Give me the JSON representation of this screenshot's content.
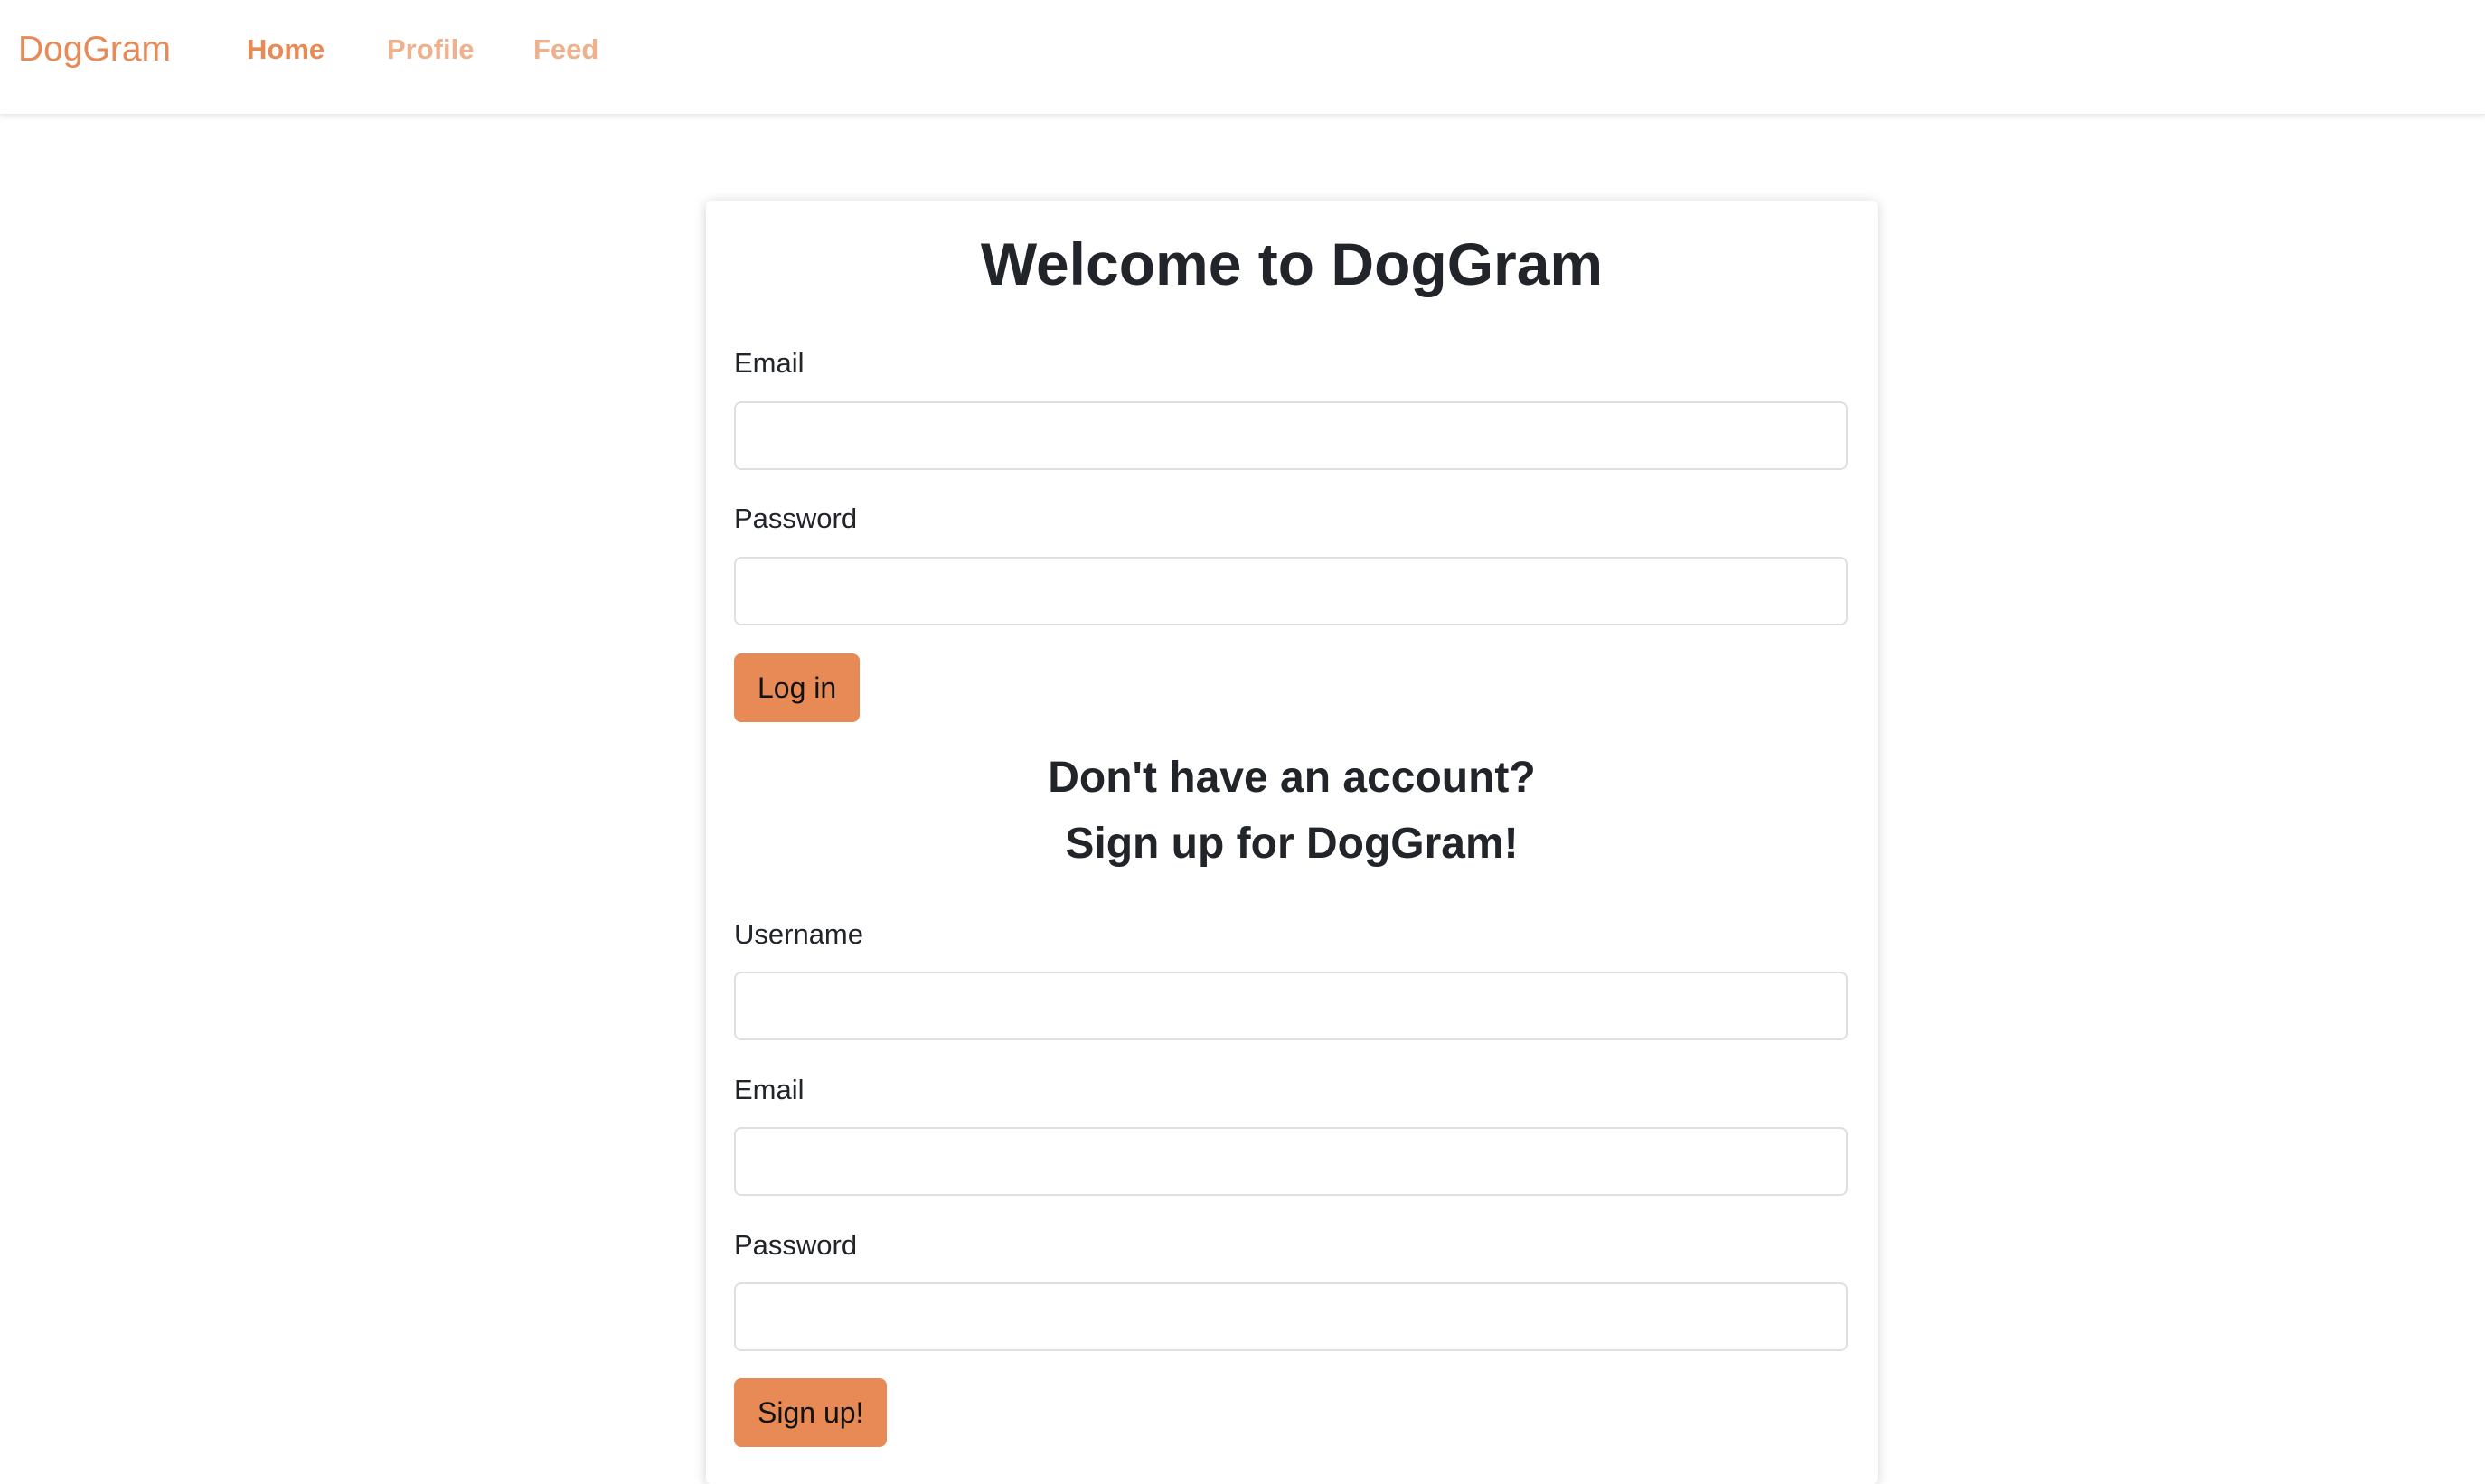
{
  "nav": {
    "brand": "DogGram",
    "links": [
      {
        "label": "Home",
        "active": true
      },
      {
        "label": "Profile",
        "active": false
      },
      {
        "label": "Feed",
        "active": false
      }
    ]
  },
  "colors": {
    "accent": "#e88a55",
    "accent_muted": "#efb08c",
    "text": "#212529"
  },
  "login": {
    "title": "Welcome to DogGram",
    "email_label": "Email",
    "email_value": "",
    "password_label": "Password",
    "password_value": "",
    "submit_label": "Log in"
  },
  "signup": {
    "heading_line1": "Don't have an account?",
    "heading_line2": "Sign up for DogGram!",
    "username_label": "Username",
    "username_value": "",
    "email_label": "Email",
    "email_value": "",
    "password_label": "Password",
    "password_value": "",
    "submit_label": "Sign up!"
  }
}
